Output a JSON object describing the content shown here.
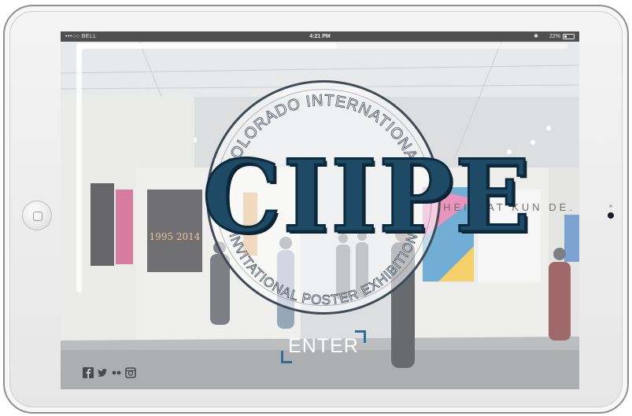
{
  "status_bar": {
    "carrier": "•••○○ BELL",
    "wifi_icon": "wifi-icon",
    "time": "4:21 PM",
    "bluetooth_icon": "bluetooth-icon",
    "battery_percent": "22%",
    "battery_level": 0.22
  },
  "logo": {
    "top_arc_text": "COLORADO INTERNATIONAL",
    "letters": "CIIPE",
    "bottom_arc_text": "INVITATIONAL POSTER EXHIBITION"
  },
  "enter": {
    "label": "ENTER"
  },
  "scroll_progress": 0.53,
  "gallery": {
    "poster_text_1": "1995 2014",
    "poster_text_2": "HEI MAT KUN DE."
  },
  "social": [
    {
      "name": "facebook-icon"
    },
    {
      "name": "twitter-icon"
    },
    {
      "name": "flickr-icon"
    },
    {
      "name": "instagram-icon"
    }
  ],
  "colors": {
    "logo_blue": "#1f4a66",
    "accent_blue": "#2b6e9a",
    "badge_ring": "#3f4b57"
  }
}
